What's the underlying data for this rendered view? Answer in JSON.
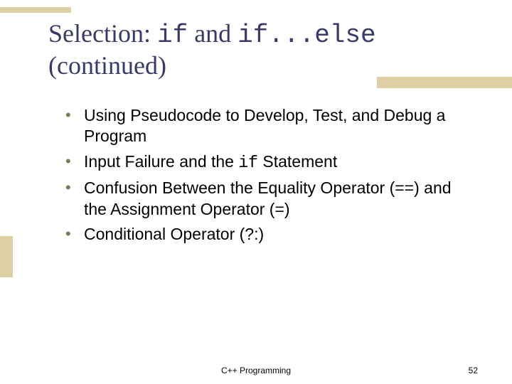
{
  "title": {
    "prefix": "Selection: ",
    "code1": "if",
    "mid": " and ",
    "code2": "if...else",
    "suffix": " (continued)"
  },
  "bullets": [
    {
      "pre": "Using Pseudocode to Develop, Test, and Debug a Program",
      "code": "",
      "post": ""
    },
    {
      "pre": "Input Failure and the ",
      "code": "if",
      "post": " Statement"
    },
    {
      "pre": "Confusion Between the Equality Operator (==) and the Assignment Operator (=)",
      "code": "",
      "post": ""
    },
    {
      "pre": "Conditional Operator (?:)",
      "code": "",
      "post": ""
    }
  ],
  "footer": {
    "text": "C++ Programming",
    "page": "52"
  }
}
